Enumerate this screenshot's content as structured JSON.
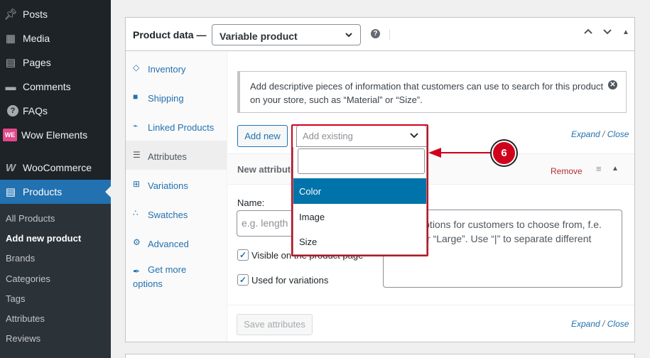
{
  "sidebar": {
    "menu": [
      {
        "label": "Posts",
        "icon": "pin-icon"
      },
      {
        "label": "Media",
        "icon": "media-icon"
      },
      {
        "label": "Pages",
        "icon": "pages-icon"
      },
      {
        "label": "Comments",
        "icon": "comments-icon"
      },
      {
        "label": "FAQs",
        "icon": "question-icon"
      },
      {
        "label": "Wow Elements",
        "icon": "wow-elements-icon"
      },
      {
        "label": "WooCommerce",
        "icon": "woocommerce-icon"
      },
      {
        "label": "Products",
        "icon": "products-icon"
      }
    ],
    "submenu": [
      "All Products",
      "Add new product",
      "Brands",
      "Categories",
      "Tags",
      "Attributes",
      "Reviews"
    ],
    "current_submenu": "Add new product",
    "accent_color": "#2271b1"
  },
  "product_data": {
    "title": "Product data —",
    "type_value": "Variable product",
    "tabs": [
      "Inventory",
      "Shipping",
      "Linked Products",
      "Attributes",
      "Variations",
      "Swatches",
      "Advanced",
      "Get more options"
    ],
    "active_tab": "Attributes",
    "notice": "Add descriptive pieces of information that customers can use to search for this product on your store, such as “Material” or “Size”.",
    "add_new_label": "Add new",
    "add_existing_placeholder": "Add existing",
    "expand_label": "Expand",
    "link_separator": "/",
    "close_label": "Close",
    "attribute_title": "New attribute",
    "remove_label": "Remove",
    "name_label": "Name:",
    "name_placeholder": "e.g. length or weight",
    "values_text": "Enter options for customers to choose from, f.e. “Blue” or “Large”. Use “|” to separate different",
    "visible_label": "Visible on the product page",
    "used_for_variations_label": "Used for variations",
    "save_label": "Save attributes"
  },
  "dropdown": {
    "options": [
      "Color",
      "Image",
      "Size"
    ],
    "highlighted": "Color"
  },
  "annotation": {
    "step": "6",
    "color": "#d0021b"
  }
}
